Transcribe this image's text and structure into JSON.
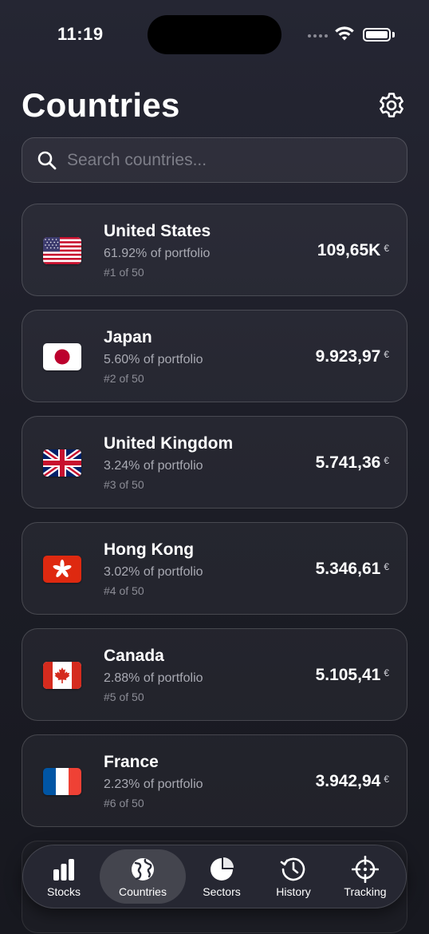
{
  "status": {
    "time": "11:19"
  },
  "header": {
    "title": "Countries"
  },
  "search": {
    "placeholder": "Search countries..."
  },
  "currency_symbol": "€",
  "countries": [
    {
      "name": "United States",
      "pct": "61.92% of portfolio",
      "rank": "#1 of 50",
      "value": "109,65K",
      "flag": "us-flag-icon"
    },
    {
      "name": "Japan",
      "pct": "5.60% of portfolio",
      "rank": "#2 of 50",
      "value": "9.923,97",
      "flag": "jp-flag-icon"
    },
    {
      "name": "United Kingdom",
      "pct": "3.24% of portfolio",
      "rank": "#3 of 50",
      "value": "5.741,36",
      "flag": "gb-flag-icon"
    },
    {
      "name": "Hong Kong",
      "pct": "3.02% of portfolio",
      "rank": "#4 of 50",
      "value": "5.346,61",
      "flag": "hk-flag-icon"
    },
    {
      "name": "Canada",
      "pct": "2.88% of portfolio",
      "rank": "#5 of 50",
      "value": "5.105,41",
      "flag": "ca-flag-icon"
    },
    {
      "name": "France",
      "pct": "2.23% of portfolio",
      "rank": "#6 of 50",
      "value": "3.942,94",
      "flag": "fr-flag-icon"
    }
  ],
  "tabs": [
    {
      "label": "Stocks",
      "icon": "bar-chart-icon"
    },
    {
      "label": "Countries",
      "icon": "globe-icon",
      "active": true
    },
    {
      "label": "Sectors",
      "icon": "pie-chart-icon"
    },
    {
      "label": "History",
      "icon": "clock-history-icon"
    },
    {
      "label": "Tracking",
      "icon": "crosshair-icon"
    }
  ]
}
